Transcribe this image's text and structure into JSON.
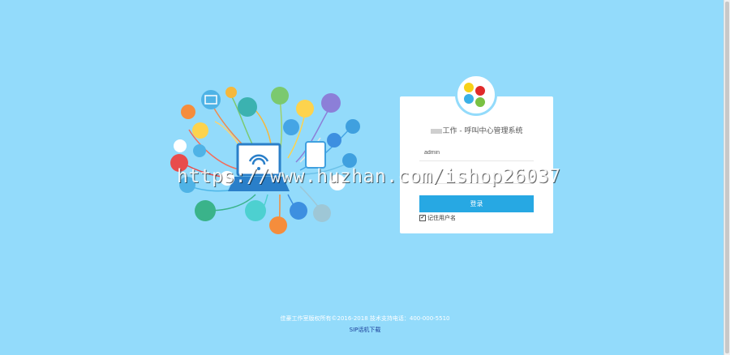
{
  "login": {
    "title_suffix": "工作 - 呼叫中心管理系统",
    "username_value": "admin",
    "password_value": "",
    "login_label": "登录",
    "remember_label": "记住用户名",
    "remember_checked": true
  },
  "logo_colors": [
    "#f7d117",
    "#e02a2a",
    "#3ab0e6",
    "#7ac142"
  ],
  "watermark": "https://www.huzhan.com/ishop26037",
  "footer": {
    "copyright": "佳豪工作室版权所有©2016-2018  技术支持电话：400-000-5510",
    "link": "SIP话机下载"
  }
}
